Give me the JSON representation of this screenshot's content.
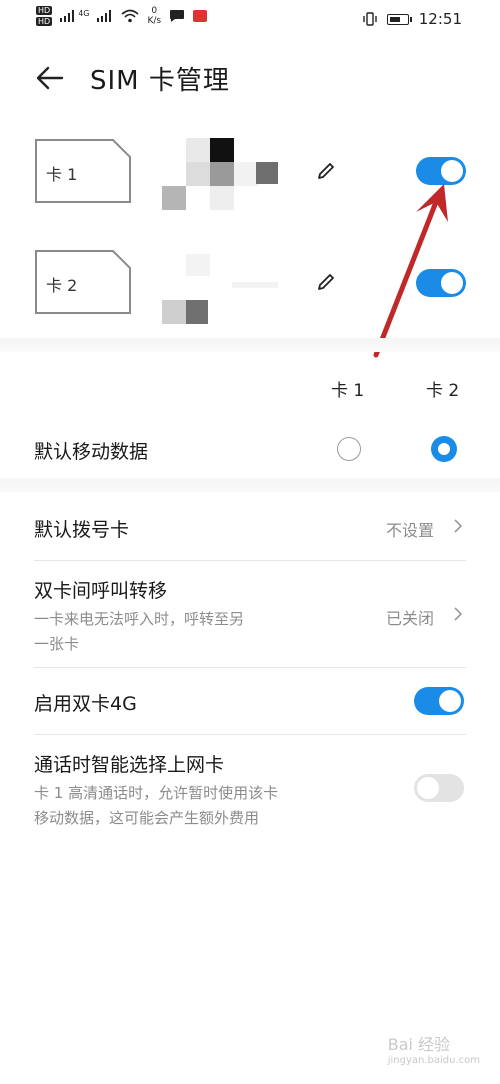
{
  "status": {
    "net_speed_value": "0",
    "net_speed_unit": "K/s",
    "time": "12:51",
    "hd": "HD",
    "lte": "4G"
  },
  "header": {
    "title": "SIM 卡管理"
  },
  "sim_cards": [
    {
      "label": "卡 1",
      "enabled": true
    },
    {
      "label": "卡 2",
      "enabled": true
    }
  ],
  "default_data": {
    "col_card1": "卡 1",
    "col_card2": "卡 2",
    "label": "默认移动数据",
    "selected": "卡 2"
  },
  "settings": {
    "default_dial": {
      "label": "默认拨号卡",
      "value": "不设置"
    },
    "call_forward": {
      "label": "双卡间呼叫转移",
      "desc_line1": "一卡来电无法呼入时，呼转至另",
      "desc_line2": "一张卡",
      "value": "已关闭"
    },
    "dual_4g": {
      "label": "启用双卡4G",
      "enabled": true
    },
    "smart_data": {
      "label": "通话时智能选择上网卡",
      "desc_line1": "卡 1 高清通话时，允许暂时使用该卡",
      "desc_line2": "移动数据，这可能会产生额外费用",
      "enabled": false
    }
  },
  "colors": {
    "accent": "#1a8ce8",
    "annotation_arrow": "#c0282a"
  },
  "watermark": {
    "brand": "Bai 经验",
    "url": "jingyan.baidu.com"
  }
}
